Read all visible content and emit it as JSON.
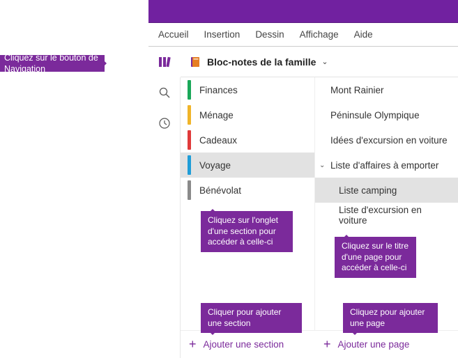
{
  "callouts": {
    "nav": "Cliquez sur le bouton de Navigation",
    "section_tab": "Cliquez sur l'onglet d'une section pour accéder à celle-ci",
    "page_title": "Cliquez sur le titre d'une page pour accéder à celle-ci",
    "add_section": "Cliquer pour ajouter une section",
    "add_page": "Cliquez pour ajouter une page"
  },
  "ribbon": {
    "tabs": [
      "Accueil",
      "Insertion",
      "Dessin",
      "Affichage",
      "Aide"
    ]
  },
  "notebook": {
    "title": "Bloc-notes de la famille"
  },
  "sections": [
    {
      "label": "Finances",
      "color": "#1aa859",
      "selected": false
    },
    {
      "label": "Ménage",
      "color": "#f0b429",
      "selected": false
    },
    {
      "label": "Cadeaux",
      "color": "#e03a3a",
      "selected": false
    },
    {
      "label": "Voyage",
      "color": "#1f9dd8",
      "selected": true
    },
    {
      "label": "Bénévolat",
      "color": "#8a8a8a",
      "selected": false
    }
  ],
  "pages": [
    {
      "label": "Mont Rainier",
      "selected": false,
      "expandable": false,
      "indent": false
    },
    {
      "label": "Péninsule Olympique",
      "selected": false,
      "expandable": false,
      "indent": false
    },
    {
      "label": "Idées d'excursion en voiture",
      "selected": false,
      "expandable": false,
      "indent": false
    },
    {
      "label": "Liste d'affaires à emporter",
      "selected": false,
      "expandable": true,
      "indent": false
    },
    {
      "label": "Liste camping",
      "selected": true,
      "expandable": false,
      "indent": true
    },
    {
      "label": "Liste d'excursion en voiture",
      "selected": false,
      "expandable": false,
      "indent": true
    }
  ],
  "actions": {
    "add_section": "Ajouter une section",
    "add_page": "Ajouter une page"
  }
}
